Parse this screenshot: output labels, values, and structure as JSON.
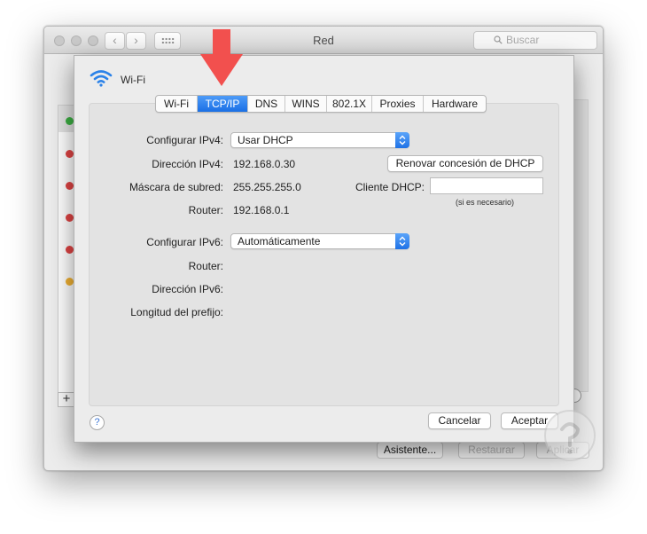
{
  "back_window": {
    "title": "Red",
    "search_placeholder": "Buscar",
    "status_colors": [
      "#3cb043",
      "#e04444",
      "#e04444",
      "#e04444",
      "#e04444",
      "#f2b233"
    ],
    "buttons": {
      "assistant": "Asistente...",
      "restore": "Restaurar",
      "apply": "Aplicar"
    },
    "add_symbol": "+"
  },
  "sheet": {
    "title": "Wi-Fi",
    "tabs": [
      {
        "label": "Wi-Fi",
        "active": false
      },
      {
        "label": "TCP/IP",
        "active": true
      },
      {
        "label": "DNS",
        "active": false
      },
      {
        "label": "WINS",
        "active": false
      },
      {
        "label": "802.1X",
        "active": false
      },
      {
        "label": "Proxies",
        "active": false
      },
      {
        "label": "Hardware",
        "active": false
      }
    ],
    "ipv4": {
      "configure_label": "Configurar IPv4:",
      "configure_value": "Usar DHCP",
      "address_label": "Dirección IPv4:",
      "address_value": "192.168.0.30",
      "mask_label": "Máscara de subred:",
      "mask_value": "255.255.255.0",
      "router_label": "Router:",
      "router_value": "192.168.0.1"
    },
    "dhcp": {
      "renew_button": "Renovar concesión de DHCP",
      "client_label": "Cliente DHCP:",
      "client_value": "",
      "client_hint": "(si es necesario)"
    },
    "ipv6": {
      "configure_label": "Configurar IPv6:",
      "configure_value": "Automáticamente",
      "router_label": "Router:",
      "address_label": "Dirección IPv6:",
      "prefix_label": "Longitud del prefijo:"
    },
    "help_symbol": "?",
    "cancel_button": "Cancelar",
    "accept_button": "Aceptar"
  },
  "colors": {
    "accent": "#1a6fe5",
    "annotation_arrow": "#f2504e"
  }
}
